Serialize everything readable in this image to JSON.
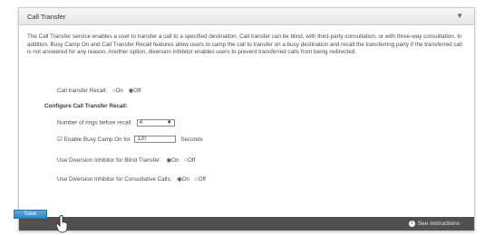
{
  "panel": {
    "title": "Call Transfer",
    "collapse_icon": "chevron-down-icon",
    "collapse_glyph": "▼"
  },
  "description": "The Call Transfer service enables a user to transfer a call to a specified destination. Call transfer can be blind, with third-party consultation, or with three-way consultation. In addition, Busy Camp On and Call Transfer Recall features allow users to camp the call to transfer on a busy destination and recall the transferring party if the transferred call is not answered for any reason. Another option, diversion inhibitor enables users to prevent transferred calls from being redirected.",
  "recall": {
    "label": "Call transfer Recall:",
    "on": "On",
    "off": "Off",
    "selected": "Off"
  },
  "configure": {
    "heading": "Configure Call Transfer Recall:",
    "rings_label": "Number of rings before recall:",
    "rings_value": "4",
    "busy_camp_label": "Enable Busy Camp On for",
    "busy_camp_value": "120",
    "seconds_label": "Seconds"
  },
  "blind": {
    "label": "Use Diversion Inhibitor for Blind Transfer:",
    "on": "On",
    "off": "Off",
    "selected": "On"
  },
  "consultative": {
    "label": "Use Diversion Inhibitor for Consultative Calls:",
    "on": "On",
    "off": "Off",
    "selected": "On"
  },
  "footer": {
    "save_label": "Save",
    "instructions_label": "See instructions",
    "info_icon": "i"
  },
  "colors": {
    "footer_bg": "#505050",
    "save_button": "#3a97d4",
    "header_bg": "#ececec"
  }
}
